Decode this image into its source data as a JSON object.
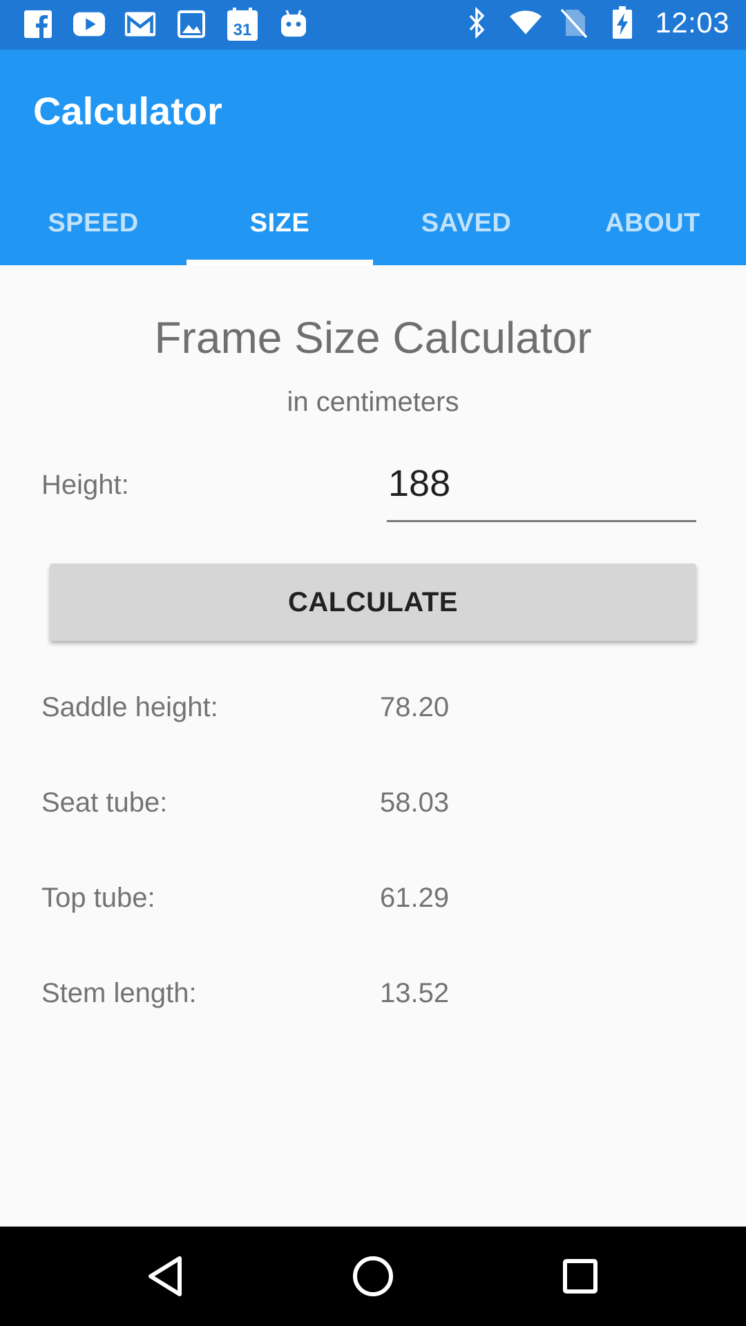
{
  "status_bar": {
    "left_icons": [
      "facebook-icon",
      "youtube-icon",
      "gmail-icon",
      "image-icon",
      "calendar-icon",
      "android-icon"
    ],
    "calendar_day": "31",
    "right_icons": [
      "bluetooth-icon",
      "wifi-icon",
      "no-sim-icon",
      "battery-charging-icon"
    ],
    "time": "12:03",
    "color": "#1E78D4"
  },
  "app_bar": {
    "title": "Calculator",
    "color": "#2196F3"
  },
  "tabs": [
    {
      "label": "SPEED",
      "active": false
    },
    {
      "label": "SIZE",
      "active": true
    },
    {
      "label": "SAVED",
      "active": false
    },
    {
      "label": "ABOUT",
      "active": false
    }
  ],
  "main": {
    "title": "Frame Size Calculator",
    "subtitle": "in centimeters",
    "height_label": "Height:",
    "height_value": "188",
    "calculate_label": "CALCULATE",
    "results": [
      {
        "label": "Saddle height:",
        "value": "78.20"
      },
      {
        "label": "Seat tube:",
        "value": "58.03"
      },
      {
        "label": "Top tube:",
        "value": "61.29"
      },
      {
        "label": "Stem length:",
        "value": "13.52"
      }
    ]
  },
  "nav_bar": {
    "buttons": [
      "back-icon",
      "home-icon",
      "recents-icon"
    ]
  }
}
